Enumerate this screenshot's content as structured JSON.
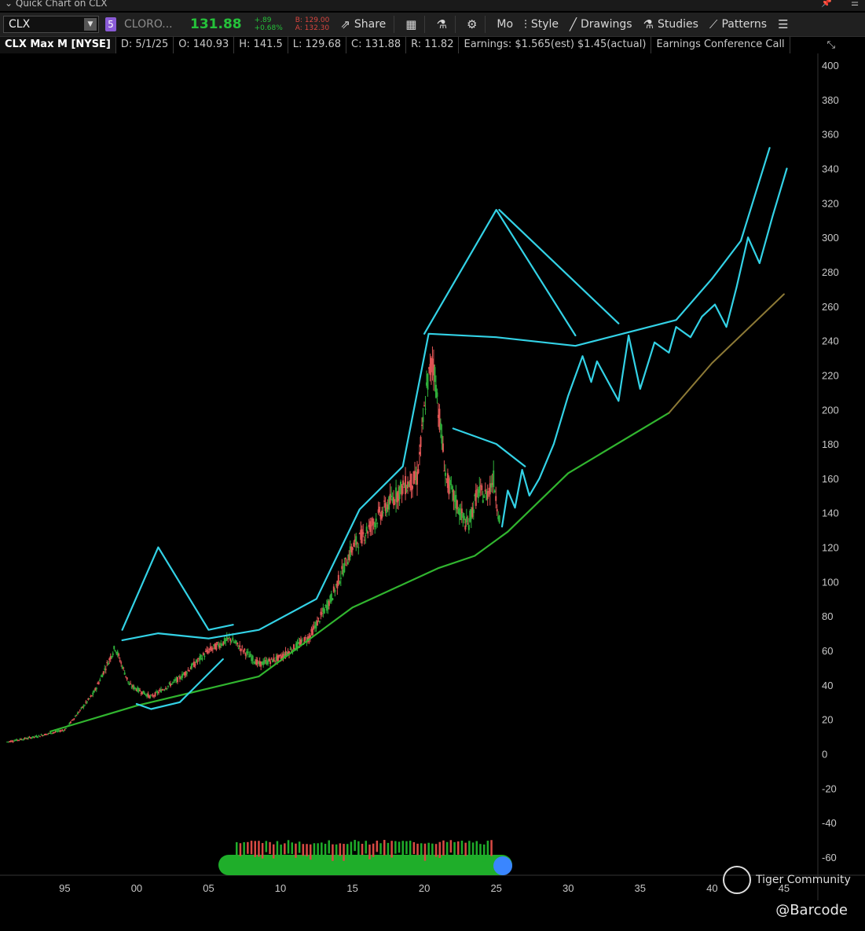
{
  "window": {
    "title": "Quick Chart on CLX"
  },
  "toolbar": {
    "symbol": "CLX",
    "badge": "5",
    "company": "CLORO...",
    "last": "131.88",
    "change": "+.89",
    "change_pct": "+0.68%",
    "bid": "B: 129.00",
    "ask": "A: 132.30",
    "share": "Share",
    "mode": "Mo",
    "style": "Style",
    "drawings": "Drawings",
    "studies": "Studies",
    "patterns": "Patterns"
  },
  "info": {
    "title": "CLX Max M [NYSE]",
    "date": "D: 5/1/25",
    "open": "O: 140.93",
    "high": "H: 141.5",
    "low": "L: 129.68",
    "close": "C: 131.88",
    "range": "R: 11.82",
    "earnings": "Earnings: $1.565(est) $1.45(actual)",
    "event": "Earnings Conference Call"
  },
  "watermark": "@Barcode",
  "brand": "Tiger Community",
  "chart_data": {
    "type": "line",
    "x_axis": {
      "ticks": [
        "95",
        "00",
        "05",
        "10",
        "15",
        "20",
        "25",
        "30",
        "35",
        "40",
        "45"
      ]
    },
    "y_axis": {
      "range": [
        -60,
        400
      ],
      "ticks": [
        400,
        380,
        360,
        340,
        320,
        300,
        280,
        260,
        240,
        220,
        200,
        180,
        160,
        140,
        120,
        100,
        80,
        60,
        40,
        20,
        0,
        -20,
        -40,
        -60
      ]
    },
    "colors": {
      "price_up": "#2fae3a",
      "price_down": "#e05555",
      "pattern": "#33d2e6",
      "support": "#31b52f",
      "projection": "#8d7a36",
      "up_volume": "#1fae2a",
      "down_volume": "#d94a44"
    },
    "series": [
      {
        "values": [
          [
            1991,
            7
          ],
          [
            1993,
            10
          ],
          [
            1995,
            14
          ],
          [
            1997,
            35
          ],
          [
            1998.5,
            62
          ],
          [
            1999.5,
            40
          ],
          [
            2001,
            33
          ],
          [
            2003,
            44
          ],
          [
            2005,
            60
          ],
          [
            2006.5,
            67
          ],
          [
            2008.5,
            52
          ],
          [
            2010,
            56
          ],
          [
            2012,
            68
          ],
          [
            2013.5,
            90
          ],
          [
            2015,
            120
          ],
          [
            2017,
            140
          ],
          [
            2018.5,
            155
          ],
          [
            2019.5,
            160
          ],
          [
            2020.2,
            215
          ],
          [
            2020.6,
            230
          ],
          [
            2021.5,
            160
          ],
          [
            2022.5,
            140
          ],
          [
            2023,
            132
          ],
          [
            2023.7,
            152
          ],
          [
            2024.3,
            150
          ],
          [
            2024.8,
            160
          ],
          [
            2025.3,
            131.88
          ]
        ]
      },
      {
        "values": [
          [
            1994,
            13
          ],
          [
            2000,
            28
          ],
          [
            2005,
            38
          ],
          [
            2008.5,
            45
          ],
          [
            2015,
            85
          ],
          [
            2021,
            108
          ],
          [
            2023.5,
            115
          ],
          [
            2025.8,
            129
          ],
          [
            2030,
            163
          ],
          [
            2037,
            198
          ],
          [
            2040,
            227
          ],
          [
            2045,
            267
          ]
        ]
      },
      {
        "values": [
          [
            2000,
            29
          ],
          [
            2001,
            26
          ],
          [
            2003,
            30
          ],
          [
            2006,
            55
          ]
        ]
      },
      {
        "values": [
          [
            1999,
            72
          ],
          [
            2001.5,
            120
          ],
          [
            2005,
            72
          ],
          [
            2006.7,
            75
          ]
        ]
      },
      {
        "values": [
          [
            1999,
            66
          ],
          [
            2001.5,
            70
          ],
          [
            2005,
            67
          ],
          [
            2008.5,
            72
          ],
          [
            2012.5,
            90
          ],
          [
            2015.5,
            142
          ],
          [
            2018.5,
            167
          ],
          [
            2020.3,
            244
          ],
          [
            2025,
            242
          ],
          [
            2030.5,
            237
          ],
          [
            2037.5,
            252
          ],
          [
            2040,
            276
          ],
          [
            2042,
            298
          ],
          [
            2044,
            352
          ]
        ]
      },
      {
        "values": [
          [
            2020,
            244
          ],
          [
            2025,
            316
          ],
          [
            2030.5,
            243
          ]
        ]
      },
      {
        "values": [
          [
            2025.2,
            316
          ],
          [
            2033.5,
            250
          ]
        ]
      },
      {
        "values": [
          [
            2022,
            189
          ],
          [
            2025,
            180
          ],
          [
            2027,
            167
          ]
        ]
      },
      {
        "values": [
          [
            2025.4,
            132
          ],
          [
            2025.8,
            153
          ],
          [
            2026.3,
            143
          ],
          [
            2026.8,
            165
          ],
          [
            2027.3,
            150
          ],
          [
            2028,
            160
          ],
          [
            2029,
            180
          ],
          [
            2030,
            208
          ],
          [
            2031,
            231
          ],
          [
            2031.6,
            216
          ],
          [
            2032,
            228
          ],
          [
            2033.5,
            205
          ],
          [
            2034.2,
            243
          ],
          [
            2035,
            212
          ],
          [
            2036,
            239
          ],
          [
            2037,
            233
          ],
          [
            2037.5,
            248
          ],
          [
            2038.5,
            242
          ],
          [
            2039.3,
            254
          ],
          [
            2040.2,
            261
          ],
          [
            2041,
            248
          ],
          [
            2041.7,
            271
          ],
          [
            2042.5,
            300
          ],
          [
            2043.3,
            285
          ],
          [
            2044.2,
            312
          ],
          [
            2045.2,
            340
          ]
        ]
      }
    ],
    "annotations": []
  }
}
